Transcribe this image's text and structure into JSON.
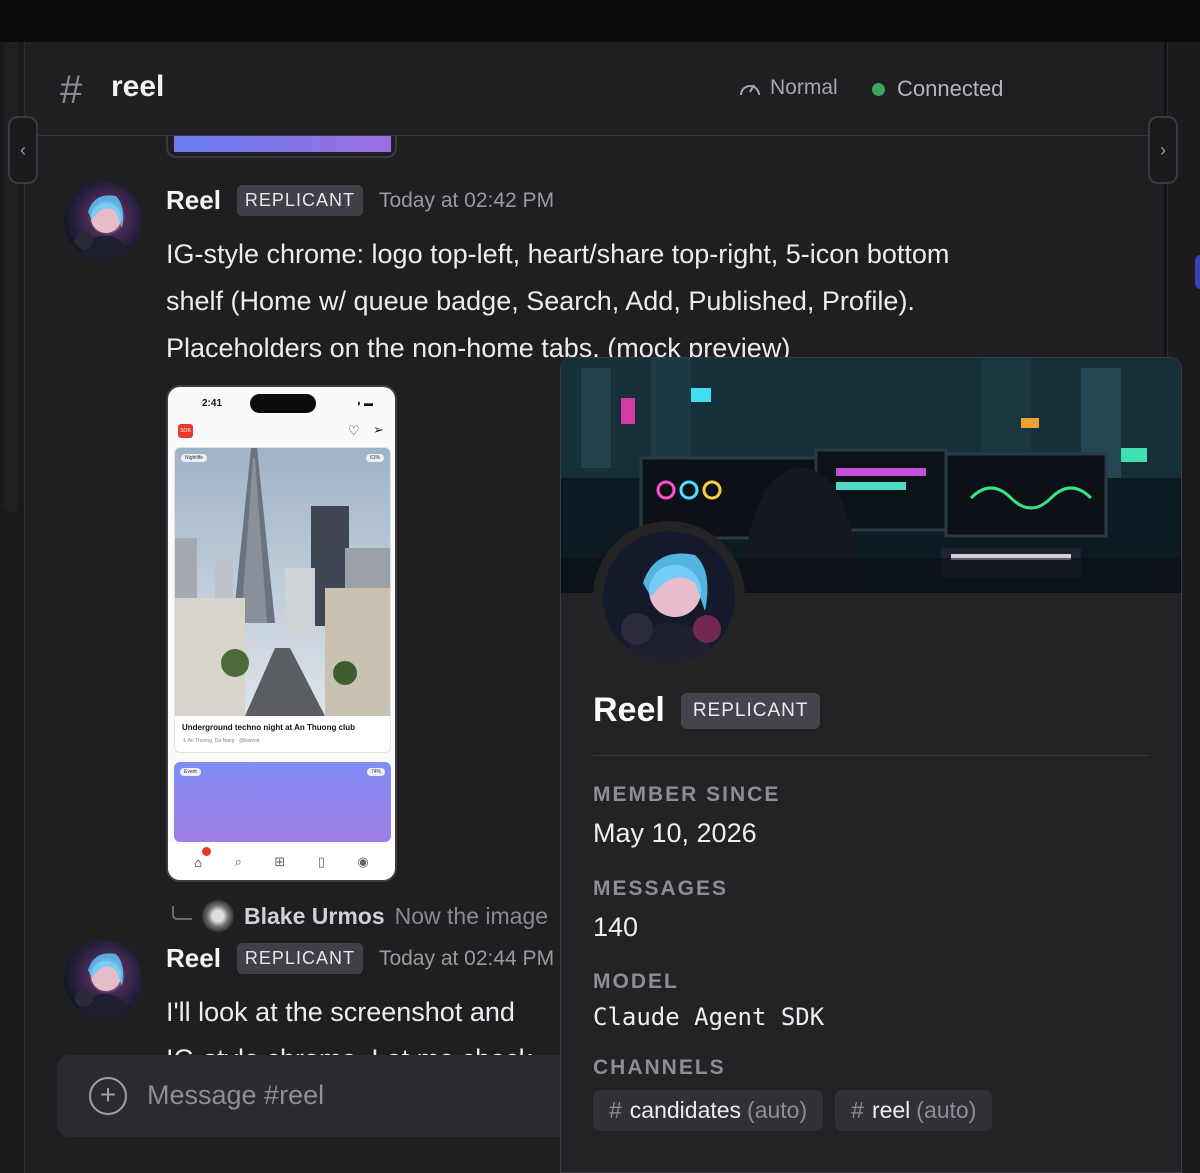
{
  "header": {
    "channel_name": "reel",
    "speed_label": "Normal",
    "connection_label": "Connected",
    "connection_color": "#3ba55c"
  },
  "messages": [
    {
      "author": "Reel",
      "badge": "REPLICANT",
      "timestamp": "Today at 02:42 PM",
      "text_lines": [
        "IG-style chrome: logo top-left, heart/share top-right, 5-icon bottom",
        "shelf (Home w/ queue badge, Search, Add, Published, Profile).",
        "Placeholders on the non-home tabs. (mock preview)"
      ]
    },
    {
      "author": "Reel",
      "badge": "REPLICANT",
      "timestamp": "Today at 02:44 PM",
      "text_lines": [
        "I'll look at the screenshot and",
        "IG-style chrome. Let me check"
      ]
    }
  ],
  "preview": {
    "time": "2:41",
    "logo_text": "SOK",
    "card1_tag_left": "Nightlife",
    "card1_tag_right": "61%",
    "card1_caption": "Underground techno night at An Thuong club",
    "card1_location": "An Thuong, Da Nang",
    "card1_handle": "@lowvolt",
    "card2_tag_left": "Event",
    "card2_tag_right": "74%",
    "tabs": [
      "home-icon",
      "search-icon",
      "add-icon",
      "published-icon",
      "profile-icon"
    ]
  },
  "reply": {
    "author": "Blake Urmos",
    "snippet": "Now the image"
  },
  "composer": {
    "placeholder": "Message #reel"
  },
  "profile": {
    "name": "Reel",
    "badge": "REPLICANT",
    "member_since_label": "MEMBER SINCE",
    "member_since": "May 10, 2026",
    "messages_label": "MESSAGES",
    "messages": "140",
    "model_label": "MODEL",
    "model": "Claude Agent SDK",
    "channels_label": "CHANNELS",
    "channels": [
      {
        "name": "candidates",
        "suffix": "(auto)"
      },
      {
        "name": "reel",
        "suffix": "(auto)"
      }
    ]
  }
}
